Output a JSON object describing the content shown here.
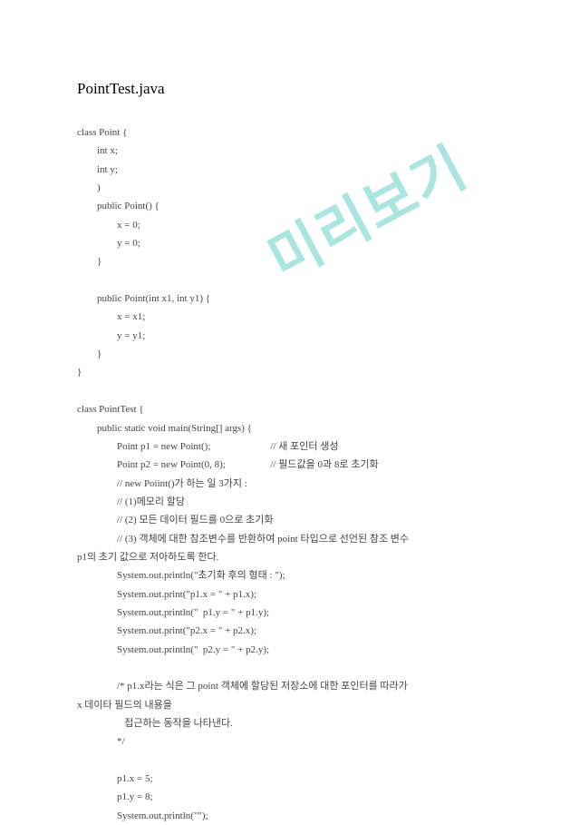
{
  "document": {
    "title": "PointTest.java",
    "watermark": "미리보기",
    "code": "class Point {\n        int x;\n        int y;\n        )\n        public Point() {\n                x = 0;\n                y = 0;\n        }\n\n        public Point(int x1, int y1) {\n                x = x1;\n                y = y1;\n        }\n}\n\nclass PointTest {\n        public static void main(String[] args) {\n                Point p1 = new Point();                        // 새 포인터 생성\n                Point p2 = new Point(0, 8);                  // 필드값을 0과 8로 초기화\n                // new Poiint()가 하는 일 3가지 :\n                // (1)메모리 할당\n                // (2) 모든 데이터 필드를 0으로 초기화\n                // (3) 객체에 대한 참조변수를 반환하여 point 타입으로 선언된 참조 변수\np1의 초기 값으로 저아하도록 한다.\n                System.out.println(\"초기화 후의 형태 : \");\n                System.out.print(\"p1.x = \" + p1.x);\n                System.out.println(\"  p1.y = \" + p1.y);\n                System.out.print(\"p2.x = \" + p2.x);\n                System.out.println(\"  p2.y = \" + p2.y);\n\n                /* p1.x라는 식은 그 point 객체에 할당된 저장소에 대한 포인터를 따라가\nx 데이타 필드의 내용을\n                   접근하는 동작을 나타낸다.\n                */\n\n                p1.x = 5;\n                p1.y = 8;\n                System.out.println(\"\");"
  }
}
